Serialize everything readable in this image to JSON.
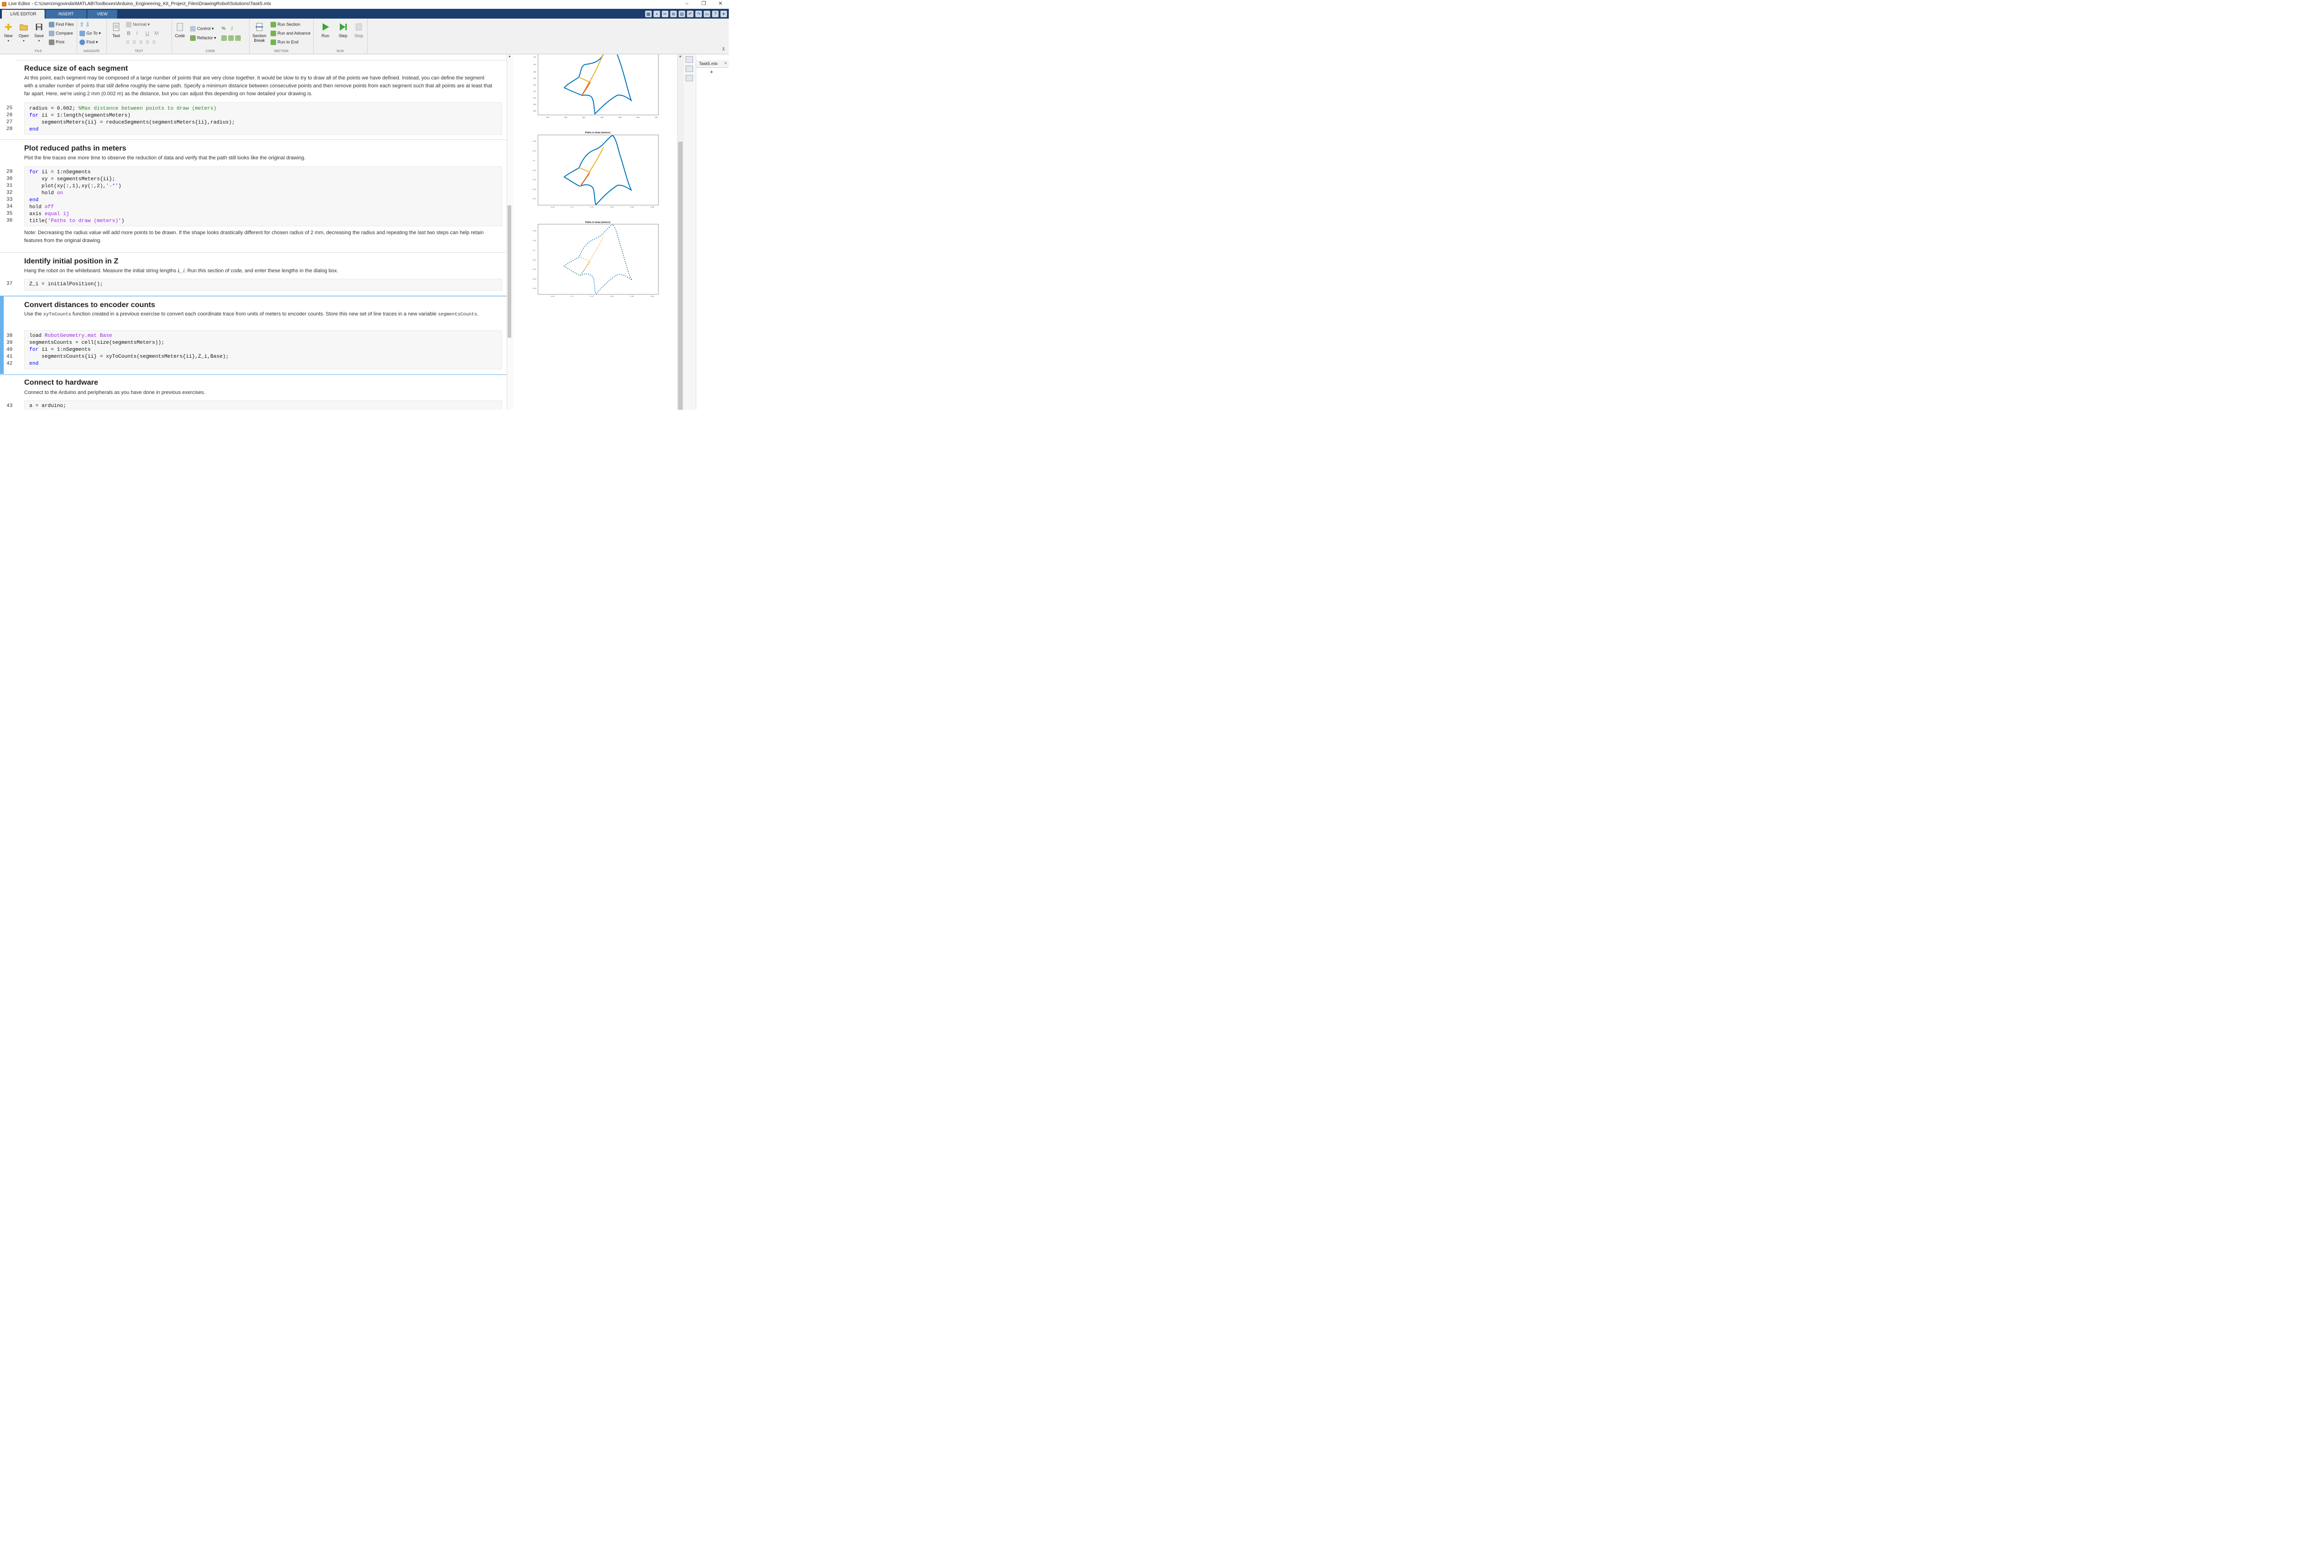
{
  "window": {
    "title": "Live Editor - C:\\Users\\mgovinda\\MATLAB\\Toolboxes\\Arduino_Engineering_Kit_Project_Files\\DrawingRobot\\Solutions\\Task5.mlx",
    "controls": [
      "–",
      "❐",
      "✕"
    ]
  },
  "tabs": [
    "LIVE EDITOR",
    "INSERT",
    "VIEW"
  ],
  "ribbon": {
    "file": {
      "label": "FILE",
      "new": "New",
      "open": "Open",
      "save": "Save",
      "find_files": "Find Files",
      "compare": "Compare",
      "print": "Print"
    },
    "navigate": {
      "label": "NAVIGATE",
      "go_to": "Go To",
      "find": "Find"
    },
    "text": {
      "label": "TEXT",
      "text_btn": "Text",
      "style": "Normal",
      "bold": "B",
      "italic": "I",
      "underline": "U",
      "mono": "M"
    },
    "code": {
      "label": "CODE",
      "code_btn": "Code",
      "control": "Control",
      "refactor": "Refactor"
    },
    "section": {
      "label": "SECTION",
      "section_break": "Section Break",
      "run_section": "Run Section",
      "run_advance": "Run and Advance",
      "run_end": "Run to End"
    },
    "run": {
      "label": "RUN",
      "run": "Run",
      "step": "Step",
      "stop": "Stop"
    }
  },
  "sections": [
    {
      "heading": "Reduce size of each segment",
      "text": "At this point, each segment may be composed of a large number of points that are very close together. It would be slow to try to draw all of the points we have defined. Instead, you can define the segment with a smaller number of points that still define roughly the same path. Specify a minimum distance between consecutive points and then remove points from each segment such that all points are at least that far apart. Here, we're using 2 mm (0.002 m) as the distance, but you can adjust this depending on how detailed your drawing is.",
      "lines": [
        "25",
        "26",
        "27",
        "28"
      ]
    },
    {
      "heading": "Plot reduced paths in meters",
      "text": "Plot the line traces one more time to observe the reduction of data and verify that the path still looks like the original drawing.",
      "lines": [
        "29",
        "30",
        "31",
        "32",
        "33",
        "34",
        "35",
        "36"
      ],
      "note": "Note: Decreasing the radius value will add more points to be drawn. If the shape looks drastically different for chosen radius of 2 mm, decreasing the radius and repeating the last two steps can help retain features from the original drawing."
    },
    {
      "heading": "Identify initial position in Z",
      "text_a": "Hang the robot on the whiteboard. Measure the initial string lengths ",
      "text_var": "L_i",
      "text_b": ". Run this section of code, and enter these lengths in the dialog box.",
      "lines": [
        "37"
      ],
      "code": "Z_i = initialPosition();"
    },
    {
      "heading": "Convert distances to encoder counts",
      "text_a": "Use the ",
      "text_fn": "xyToCounts",
      "text_b": " function created in a previous exercise to convert each coordinate trace from units of meters to encoder counts. Store this new set of line traces in a new variable ",
      "text_var": "segmentsCounts",
      "text_c": ".",
      "lines": [
        "38",
        "39",
        "40",
        "41",
        "42"
      ]
    },
    {
      "heading": "Connect to hardware",
      "text": "Connect to the Arduino and peripherals as you have done in previous exercises.",
      "lines": [
        "43"
      ],
      "code": "a = arduino;"
    }
  ],
  "code_tokens": {
    "s1_l1_a": "radius = 0.002; ",
    "s1_l1_c": "%Max distance between points to draw (meters)",
    "for": "for",
    "s1_l2": " ii = 1:length(segmentsMeters)",
    "s1_l3": "    segmentsMeters{ii} = reduceSegments(segmentsMeters{ii},radius);",
    "end": "end",
    "s2_l1": " ii = 1:nSegments",
    "s2_l2": "    xy = segmentsMeters{ii};",
    "s2_l3_a": "    plot(xy(:,1),xy(:,2),",
    "s2_l3_s": "'-*'",
    "s2_l3_b": ")",
    "s2_l4_a": "    hold ",
    "on": "on",
    "hold": "hold ",
    "off": "off",
    "axis": "axis ",
    "equal_ij": "equal ij",
    "title_a": "title(",
    "title_s": "'Paths to draw (meters)'",
    "title_b": ")",
    "load": "load ",
    "load_s": "RobotGeometry.mat Base",
    "s4_l2": "segmentsCounts = cell(size(segmentsMeters));",
    "s4_l4": "    segmentsCounts{ii} = xyToCounts(segmentsMeters{ii},Z_i,Base);"
  },
  "figures": [
    {
      "title": "",
      "x_ticks": [
        "400",
        "450",
        "500",
        "550",
        "600",
        "650",
        "700"
      ],
      "y_ticks": [
        "120",
        "140",
        "160",
        "180",
        "200",
        "220",
        "240",
        "260",
        "280"
      ]
    },
    {
      "title": "Paths to draw (meters)",
      "x_ticks": [
        "0.18",
        "0.2",
        "0.22",
        "0.24",
        "0.26",
        "0.28"
      ],
      "y_ticks": [
        "0.18",
        "0.19",
        "0.2",
        "0.21",
        "0.22",
        "0.23",
        "0.24"
      ]
    },
    {
      "title": "Paths to draw (meters)",
      "x_ticks": [
        "0.18",
        "0.2",
        "0.22",
        "0.24",
        "0.26",
        "0.28"
      ],
      "y_ticks": [
        "0.18",
        "0.19",
        "0.2",
        "0.21",
        "0.22",
        "0.23",
        "0.24"
      ]
    }
  ],
  "right_panel": {
    "file_tab": "Task5.mlx",
    "close": "✕",
    "add": "+"
  },
  "colors": {
    "accent_blue": "#1b3d6e",
    "series_blue": "#0072bd",
    "series_orange": "#d95319",
    "series_yellow": "#edb120",
    "run_green": "#2ca02c"
  }
}
